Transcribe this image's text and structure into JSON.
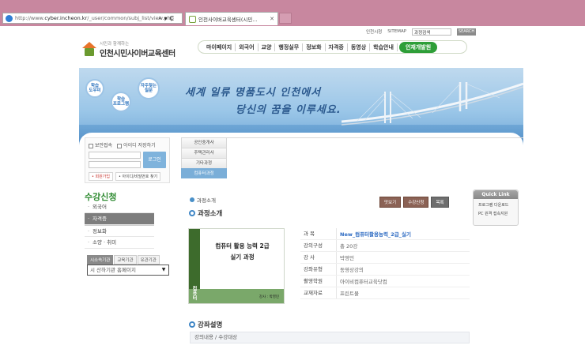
{
  "browser": {
    "url_prefix": "http://www.",
    "url_domain": "cyber.incheon.kr",
    "url_rest": "/_user/common/subj_list/view.php",
    "tools": [
      "⌕",
      "▾",
      "C"
    ],
    "tab_title": "인천사이버교육센터(시민...",
    "tab_close": "✕"
  },
  "header": {
    "slogan": "시민과 함께하는",
    "site_name": "인천시민사이버교육센터",
    "util_links": [
      "인천시청",
      "SITEMAP"
    ],
    "search_value": "과정검색",
    "search_button": "SEARCH",
    "nav": [
      "마이페이지",
      "외국어",
      "교양",
      "행정실무",
      "정보화",
      "자격증",
      "동영상",
      "학습안내"
    ],
    "nav_highlight": "인재개발원"
  },
  "banner": {
    "line1": "세계 일류 명품도시 인천에서",
    "line2": "당신의 꿈을 이루세요.",
    "bubbles": [
      "학습\n도우미",
      "학습\n프로그램",
      "자주찾는\n질문"
    ]
  },
  "login": {
    "security_label": "보안접속",
    "save_id_label": "아이디 저장하기",
    "login_button": "로그인",
    "signup_link": "• 회원가입",
    "find_link": "• 아이디/비밀번호 찾기"
  },
  "subtabs": [
    "공인중개사",
    "주택관리사",
    "기타과정",
    "컴퓨터과정"
  ],
  "sidebar": {
    "title": "수강신청",
    "items": [
      "외국어",
      "자격증",
      "정보화",
      "소양 · 취미"
    ],
    "org_tabs": [
      "시소속기관",
      "교육기관",
      "유관기관"
    ],
    "org_select": "시 산하기관 홈페이지"
  },
  "main": {
    "breadcrumb": "과정소개",
    "buttons": [
      "맛보기",
      "수강신청",
      "목록"
    ],
    "section_title": "과정소개",
    "thumbnail": {
      "title1": "컴퓨터 활용 능력 2급",
      "title2": "실기 과정",
      "author": "강사 : 박영민",
      "side": "컴퓨터"
    },
    "info": [
      {
        "key": "과 목",
        "value": "New_컴퓨터활용능력_2급_실기"
      },
      {
        "key": "강의구성",
        "value": "총 20강"
      },
      {
        "key": "강 사",
        "value": "박영민"
      },
      {
        "key": "강좌유형",
        "value": "동영상강의"
      },
      {
        "key": "촬영학원",
        "value": "아이비컴퓨터교육닷컴"
      },
      {
        "key": "교재자료",
        "value": "프린트물"
      }
    ],
    "section_title2": "강좌설명",
    "lecture_bar": "강의내용 / 수강대상"
  },
  "quick_link": {
    "title": "Quick Link",
    "items": [
      "프로그램 다운로드",
      "PC 원격 접속지원"
    ]
  }
}
